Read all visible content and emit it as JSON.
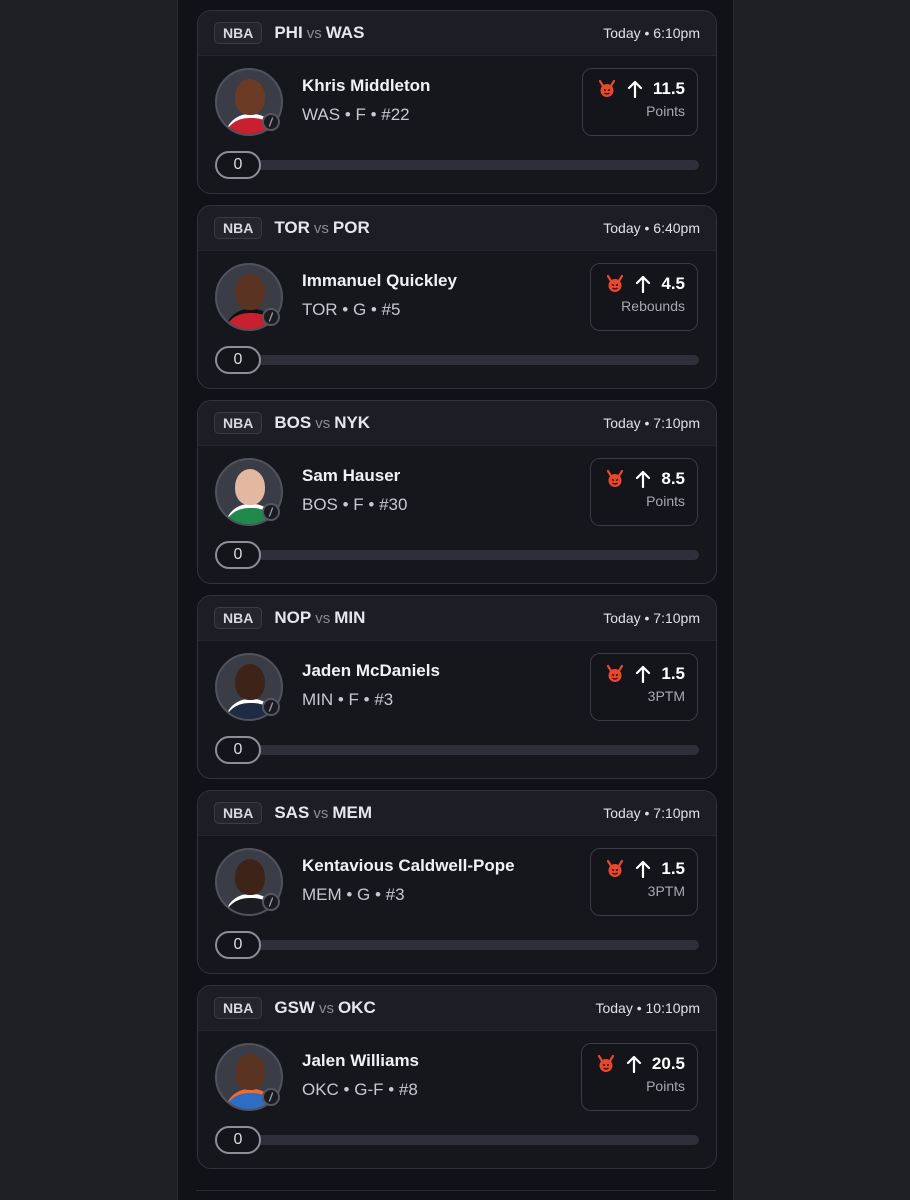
{
  "cards": [
    {
      "league": "NBA",
      "home": "PHI",
      "vs": "vs",
      "away": "WAS",
      "time": "Today • 6:10pm",
      "player": "Khris Middleton",
      "meta": "WAS • F • #22",
      "line": "11.5",
      "stat": "Points",
      "progress": "0",
      "skin": "#6b3b26",
      "jersey": "#c8202f",
      "jersey_trim": "#ffffff"
    },
    {
      "league": "NBA",
      "home": "TOR",
      "vs": "vs",
      "away": "POR",
      "time": "Today • 6:40pm",
      "player": "Immanuel Quickley",
      "meta": "TOR • G • #5",
      "line": "4.5",
      "stat": "Rebounds",
      "progress": "0",
      "skin": "#5a3322",
      "jersey": "#c8202f",
      "jersey_trim": "#111111"
    },
    {
      "league": "NBA",
      "home": "BOS",
      "vs": "vs",
      "away": "NYK",
      "time": "Today • 7:10pm",
      "player": "Sam Hauser",
      "meta": "BOS • F • #30",
      "line": "8.5",
      "stat": "Points",
      "progress": "0",
      "skin": "#e2b9a0",
      "jersey": "#1f8a4c",
      "jersey_trim": "#ffffff"
    },
    {
      "league": "NBA",
      "home": "NOP",
      "vs": "vs",
      "away": "MIN",
      "time": "Today • 7:10pm",
      "player": "Jaden McDaniels",
      "meta": "MIN • F • #3",
      "line": "1.5",
      "stat": "3PTM",
      "progress": "0",
      "skin": "#3e2418",
      "jersey": "#1f2a44",
      "jersey_trim": "#ffffff"
    },
    {
      "league": "NBA",
      "home": "SAS",
      "vs": "vs",
      "away": "MEM",
      "time": "Today • 7:10pm",
      "player": "Kentavious Caldwell-Pope",
      "meta": "MEM • G • #3",
      "line": "1.5",
      "stat": "3PTM",
      "progress": "0",
      "skin": "#3e2418",
      "jersey": "#1b1c22",
      "jersey_trim": "#ffffff"
    },
    {
      "league": "NBA",
      "home": "GSW",
      "vs": "vs",
      "away": "OKC",
      "time": "Today • 10:10pm",
      "player": "Jalen Williams",
      "meta": "OKC • G-F • #8",
      "line": "20.5",
      "stat": "Points",
      "progress": "0",
      "skin": "#5a3322",
      "jersey": "#2f6cc4",
      "jersey_trim": "#f26a2e"
    }
  ],
  "icons": {
    "devil": "devil-icon",
    "arrow": "arrow-up-icon",
    "badge": "team-badge-icon"
  },
  "colors": {
    "devil": "#e8482c",
    "card_bg": "#16171d",
    "header_bg": "#1d1e25"
  }
}
